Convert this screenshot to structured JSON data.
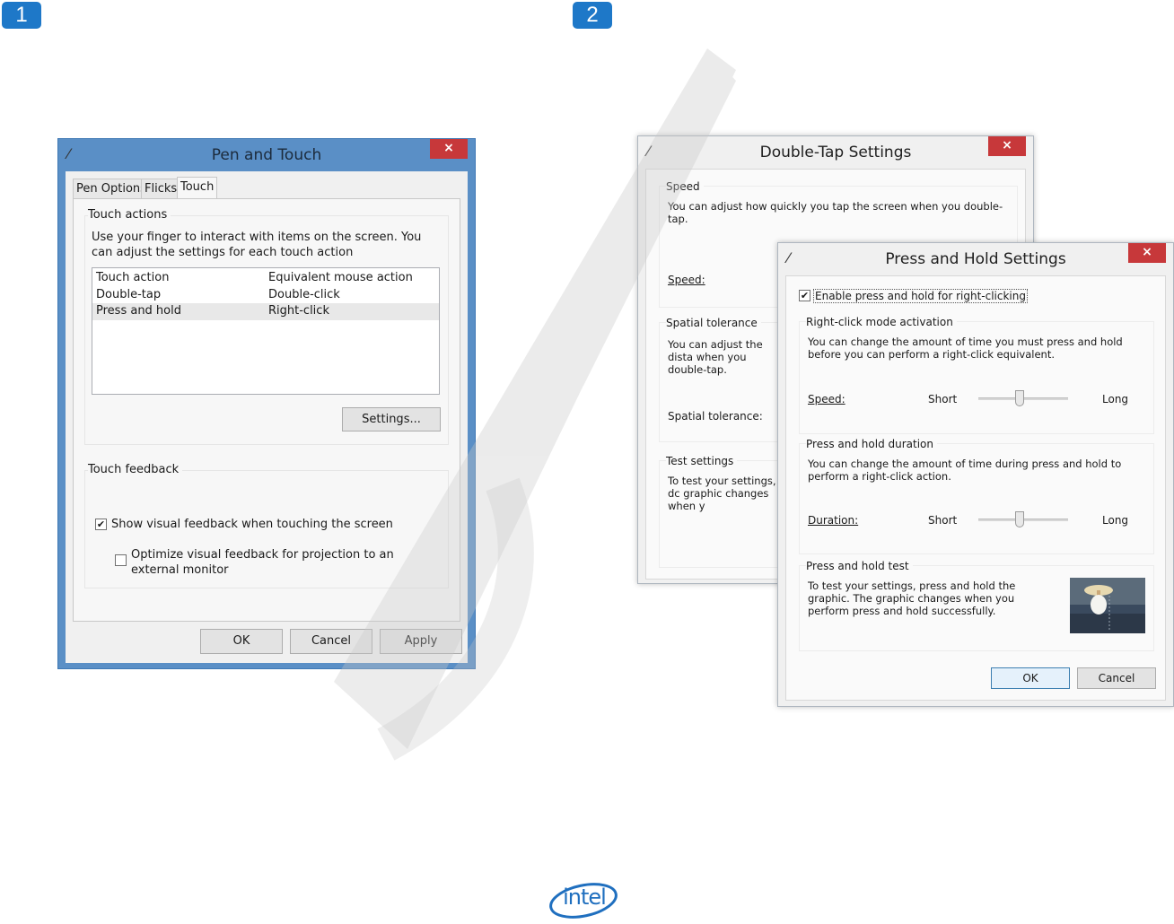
{
  "steps": {
    "one": "1",
    "two": "2"
  },
  "pen_touch": {
    "title": "Pen and Touch",
    "close": "×",
    "tabs": [
      "Pen Options",
      "Flicks",
      "Touch"
    ],
    "touch_actions": {
      "heading": "Touch actions",
      "description": "Use your finger to interact with items on the screen. You can adjust the settings for each touch action",
      "columns": [
        "Touch action",
        "Equivalent mouse action"
      ],
      "rows": [
        [
          "Double-tap",
          "Double-click"
        ],
        [
          "Press and hold",
          "Right-click"
        ]
      ],
      "settings_button": "Settings..."
    },
    "touch_feedback": {
      "heading": "Touch feedback",
      "show_visual": "Show visual feedback when touching the screen",
      "optimize_visual": "Optimize visual feedback for projection to an external monitor"
    },
    "buttons": {
      "ok": "OK",
      "cancel": "Cancel",
      "apply": "Apply"
    }
  },
  "double_tap": {
    "title": "Double-Tap Settings",
    "close": "×",
    "speed": {
      "heading": "Speed",
      "description": "You can adjust how quickly you tap the screen when you double-tap.",
      "label": "Speed:"
    },
    "spatial": {
      "heading": "Spatial tolerance",
      "description": "You can adjust the dista when you double-tap.",
      "label": "Spatial tolerance:"
    },
    "test": {
      "heading": "Test settings",
      "description": "To test your settings, dc graphic changes when y"
    }
  },
  "press_hold": {
    "title": "Press and Hold Settings",
    "close": "×",
    "enable_label": "Enable press and hold for right-clicking",
    "activation": {
      "heading": "Right-click mode activation",
      "description": "You can change the amount of time you must press and hold before you can perform a right-click equivalent.",
      "label": "Speed:",
      "min": "Short",
      "max": "Long",
      "level": 0.45
    },
    "duration": {
      "heading": "Press and hold duration",
      "description": "You can change the amount of time during press and hold to perform a right-click action.",
      "label": "Duration:",
      "min": "Short",
      "max": "Long",
      "level": 0.45
    },
    "test": {
      "heading": "Press and hold test",
      "description": "To test your settings, press and hold the graphic. The graphic changes when you perform press and hold successfully."
    },
    "buttons": {
      "ok": "OK",
      "cancel": "Cancel"
    }
  },
  "footer": {
    "logo": "intel"
  },
  "colors": {
    "badge": "#1e78c8",
    "close": "#c7383a",
    "window_frame": "#5a8fc6",
    "logo": "#1f6fbf"
  }
}
